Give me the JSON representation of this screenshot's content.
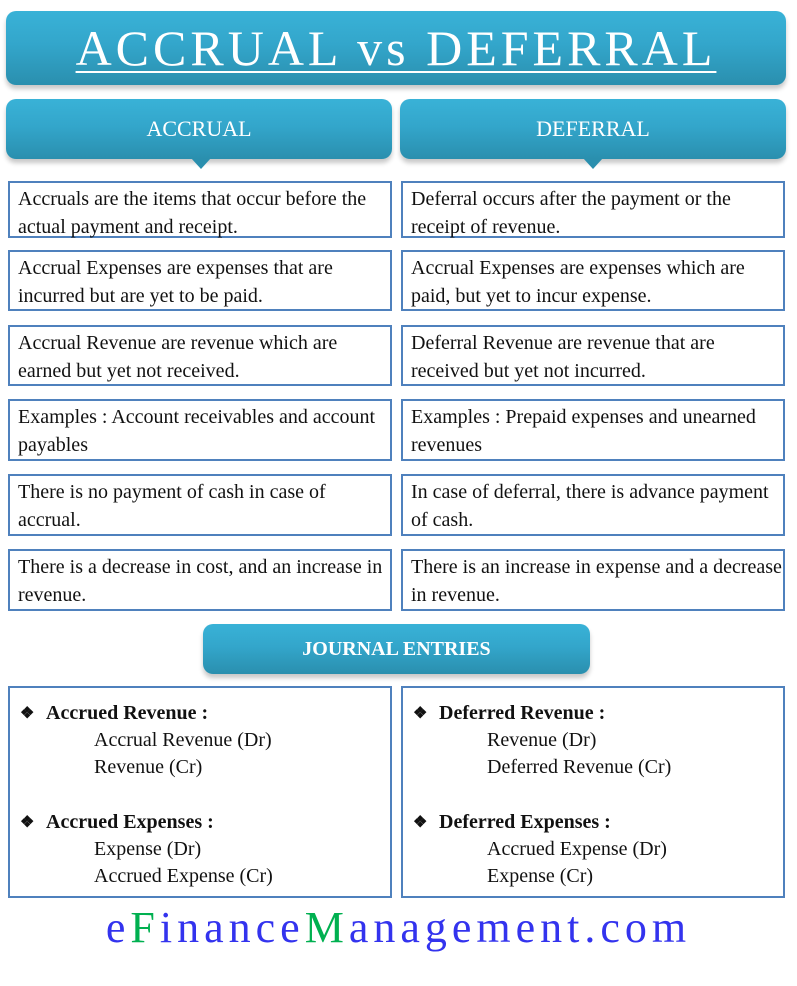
{
  "title": "ACCRUAL vs DEFERRAL",
  "columns": {
    "accrual": {
      "label": "ACCRUAL"
    },
    "deferral": {
      "label": "DEFERRAL"
    }
  },
  "comparison_rows": [
    {
      "accrual": "Accruals are the items that occur before the actual payment and receipt.",
      "deferral": "Deferral occurs after the payment or the receipt of revenue."
    },
    {
      "accrual": "Accrual Expenses are expenses that are incurred but are yet to be paid.",
      "deferral": "Accrual Expenses are expenses which are paid, but yet to incur expense."
    },
    {
      "accrual": "Accrual Revenue are revenue which are earned but yet not received.",
      "deferral": "Deferral Revenue are revenue that are received but yet not incurred."
    },
    {
      "accrual": "Examples : Account receivables and account payables",
      "deferral": "Examples : Prepaid expenses and unearned revenues"
    },
    {
      "accrual": "There is no payment of cash in case of accrual.",
      "deferral": "In case of deferral, there is advance payment of cash."
    },
    {
      "accrual": "There is a decrease in cost, and an increase in revenue.",
      "deferral": "There is an increase in expense and a decrease in revenue."
    }
  ],
  "journal": {
    "label": "JOURNAL ENTRIES",
    "bullet_icon": "❖",
    "accrual": [
      {
        "heading": "Accrued Revenue :",
        "lines": [
          "Accrual Revenue (Dr)",
          "Revenue (Cr)"
        ]
      },
      {
        "heading": "Accrued Expenses :",
        "lines": [
          "Expense (Dr)",
          "Accrued Expense (Cr)"
        ]
      }
    ],
    "deferral": [
      {
        "heading": "Deferred Revenue :",
        "lines": [
          "Revenue (Dr)",
          "Deferred Revenue (Cr)"
        ]
      },
      {
        "heading": "Deferred Expenses :",
        "lines": [
          "Accrued Expense (Dr)",
          "Expense (Cr)"
        ]
      }
    ]
  },
  "brand": {
    "parts": [
      {
        "text": "e",
        "highlight": false
      },
      {
        "text": "F",
        "highlight": true
      },
      {
        "text": "inance",
        "highlight": false
      },
      {
        "text": "M",
        "highlight": true
      },
      {
        "text": "anagement.com",
        "highlight": false
      }
    ],
    "colors": {
      "primary": "#3333ee",
      "highlight": "#00b050"
    }
  },
  "colors": {
    "header": "#33a6cb",
    "border": "#4f81bd"
  }
}
